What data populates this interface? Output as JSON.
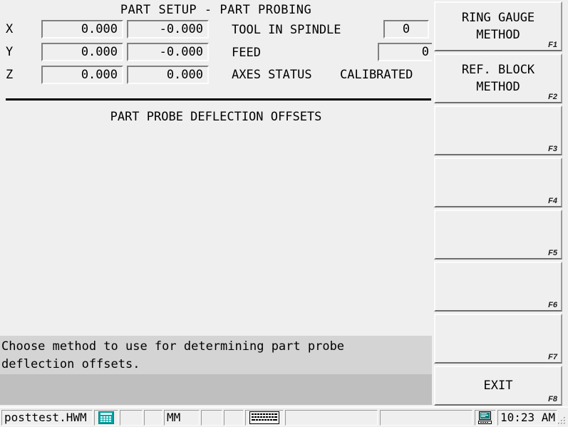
{
  "header": {
    "title": "PART SETUP - PART PROBING"
  },
  "axes": {
    "rows": [
      {
        "label": "X",
        "position": "0.000",
        "offset": "-0.000"
      },
      {
        "label": "Y",
        "position": "0.000",
        "offset": "-0.000"
      },
      {
        "label": "Z",
        "position": "0.000",
        "offset": "0.000"
      }
    ]
  },
  "info": {
    "tool_in_spindle_label": "TOOL IN SPINDLE",
    "tool_in_spindle_value": "0",
    "feed_label": "FEED",
    "feed_value": "0",
    "axes_status_label": "AXES STATUS",
    "axes_status_value": "CALIBRATED"
  },
  "section": {
    "title": "PART PROBE DEFLECTION OFFSETS"
  },
  "message": {
    "line1": "Choose method to use for determining part probe",
    "line2": "deflection offsets."
  },
  "fkeys": [
    {
      "id": "F1",
      "label": "RING GAUGE\nMETHOD"
    },
    {
      "id": "F2",
      "label": "REF. BLOCK\nMETHOD"
    },
    {
      "id": "F3",
      "label": ""
    },
    {
      "id": "F4",
      "label": ""
    },
    {
      "id": "F5",
      "label": ""
    },
    {
      "id": "F6",
      "label": ""
    },
    {
      "id": "F7",
      "label": ""
    },
    {
      "id": "F8",
      "label": "EXIT"
    }
  ],
  "statusbar": {
    "file_name": "posttest.HWM",
    "units": "MM",
    "time": "10:23 AM",
    "icons": {
      "mdi_keypad": "calculator-icon",
      "keyboard": "keyboard-icon",
      "computer": "computer-icon"
    }
  },
  "colors": {
    "background": "#efefef",
    "message_panel": "#d4d4d4",
    "status_panel": "#bfbfbf",
    "field_border_dark": "#808080",
    "icon_teal": "#008080"
  }
}
